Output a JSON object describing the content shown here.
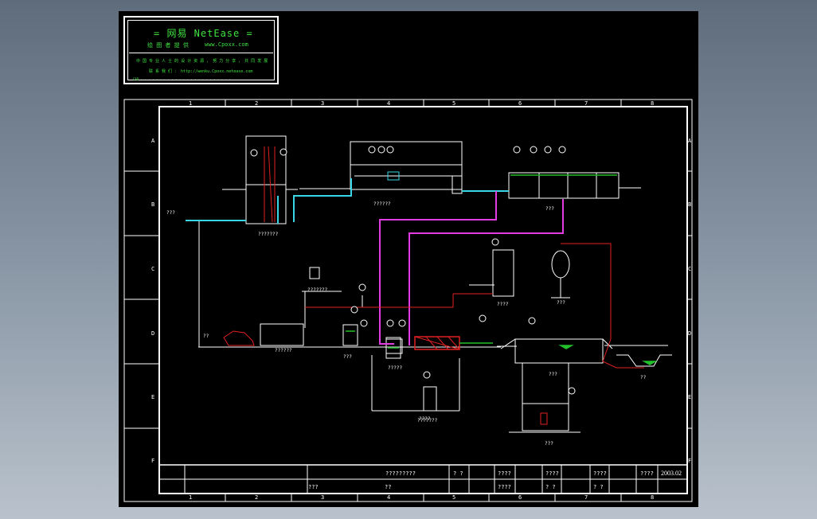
{
  "watermark": {
    "title": "= 网易 NetEase =",
    "line1_left": "绘 图 者 提 供",
    "line1_right": "www.Cpoxx.com",
    "line2": "中 国 专 业 人 士 的 设 计 资 源 ， 努 力 分 享 ， 共 同 发 展",
    "line3": "联 系 我 们 ： http://wenku.Cpoxx.netease.com",
    "line4": "CAD · · · · · · · · · · · · · · · · · · · · · · · ·"
  },
  "grid": {
    "columns": [
      "1",
      "2",
      "3",
      "4",
      "5",
      "6",
      "7",
      "8"
    ],
    "rows": [
      "A",
      "B",
      "C",
      "D",
      "E",
      "F"
    ]
  },
  "labels": {
    "inlet": "???",
    "coarse_screen": "???????",
    "distributor": "??????",
    "biotank": "???",
    "pump_pit": "??????",
    "dosing": "???????",
    "left_unit": "??",
    "mid_tank": "???",
    "sludge_tank": "?????",
    "settling": "????",
    "gas_holder": "???",
    "dewater": "???????",
    "thickener": "???",
    "pond": "??",
    "pump_house": "???",
    "small_tank": "????"
  },
  "title_block": {
    "project": "?????????",
    "c1": "? ?",
    "c2": "????",
    "c3": "????",
    "c4": "????",
    "c5": "????",
    "date": "2003.02",
    "r2a": "???",
    "r2b": "??",
    "r2c": "????",
    "r2d": "? ?",
    "r2e": "? ?"
  },
  "colors": {
    "sheet_bg": "#000000",
    "frame": "#ffffff",
    "watermark": "#3fe23f",
    "cyan": "#38d6e6",
    "magenta": "#e23be2",
    "red": "#e02020",
    "green": "#22c02a"
  }
}
